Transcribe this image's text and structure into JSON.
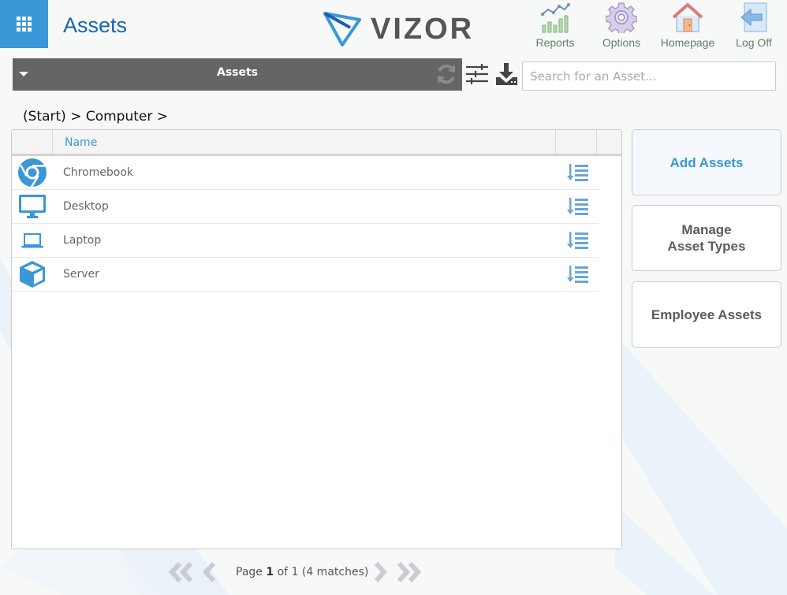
{
  "header": {
    "title": "Assets",
    "logo_text": "VIZOR",
    "nav": [
      {
        "label": "Reports",
        "icon": "reports-chart-icon"
      },
      {
        "label": "Options",
        "icon": "gear-icon"
      },
      {
        "label": "Homepage",
        "icon": "home-icon"
      },
      {
        "label": "Log Off",
        "icon": "logout-arrow-icon"
      }
    ]
  },
  "toolbar": {
    "title": "Assets",
    "search_placeholder": "Search for an Asset...",
    "search_value": ""
  },
  "breadcrumb": "(Start) > Computer >",
  "grid": {
    "columns": [
      "",
      "Name",
      ""
    ],
    "rows": [
      {
        "name": "Chromebook",
        "icon": "chrome-icon"
      },
      {
        "name": "Desktop",
        "icon": "desktop-monitor-icon"
      },
      {
        "name": "Laptop",
        "icon": "laptop-icon"
      },
      {
        "name": "Server",
        "icon": "cube-icon"
      }
    ]
  },
  "side_buttons": {
    "add": "Add Assets",
    "manage": "Manage\nAsset Types",
    "employee": "Employee Assets"
  },
  "pager": {
    "prefix": "Page",
    "current": "1",
    "suffix": "of 1 (4 matches)"
  },
  "colors": {
    "accent": "#3a97d8",
    "title": "#1a64a8",
    "toolbar_bg": "#656565",
    "background": "#f7f9f9"
  }
}
